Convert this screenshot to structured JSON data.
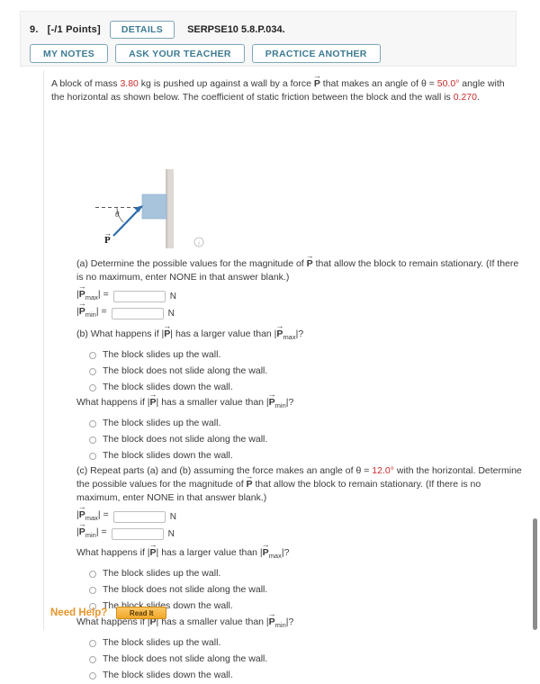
{
  "header": {
    "question_number": "9.",
    "points": "[-/1 Points]",
    "details_label": "DETAILS",
    "problem_code": "SERPSE10 5.8.P.034.",
    "my_notes_label": "MY NOTES",
    "ask_teacher_label": "ASK YOUR TEACHER",
    "practice_another_label": "PRACTICE ANOTHER"
  },
  "problem": {
    "text_part1": "A block of mass ",
    "mass_value": "3.80",
    "text_part2": " kg is pushed up against a wall by a force ",
    "force_symbol": "P",
    "text_part3": " that makes an angle of ",
    "theta_symbol": "θ",
    "equals": " = ",
    "angle_value": "50.0°",
    "text_part4": " angle with the horizontal as shown below. The coefficient of static friction between the block and the wall is ",
    "mu_value": "0.270",
    "text_part5": "."
  },
  "figure": {
    "angle_label": "θ",
    "force_label": "P",
    "watermark": "ⓘ"
  },
  "part_a": {
    "prompt_pre": "(a) Determine the possible values for the magnitude of ",
    "force_symbol": "P",
    "prompt_post": " that allow the block to remain stationary. (If there is no maximum, enter NONE in that answer blank.)",
    "max_label_base": "P",
    "max_label_sub": "max",
    "min_label_base": "P",
    "min_label_sub": "min",
    "max_value": "",
    "min_value": "",
    "unit": "N"
  },
  "part_b": {
    "prompt_larger_pre": "(b) What happens if |",
    "prompt_larger_mid": "| has a larger value than |",
    "prompt_larger_sub": "max",
    "prompt_larger_post": "|?",
    "prompt_smaller_pre": "What happens if |",
    "prompt_smaller_mid": "| has a smaller value than |",
    "prompt_smaller_sub": "min",
    "prompt_smaller_post": "|?",
    "force_symbol": "P",
    "options": [
      "The block slides up the wall.",
      "The block does not slide along the wall.",
      "The block slides down the wall."
    ]
  },
  "part_c": {
    "prompt_pre": "(c) Repeat parts (a) and (b) assuming the force makes an angle of ",
    "theta_symbol": "θ",
    "equals": " = ",
    "angle_value": "12.0°",
    "prompt_mid": " with the horizontal. Determine the possible values for the magnitude of ",
    "force_symbol": "P",
    "prompt_post": " that allow the block to remain stationary. (If there is no maximum, enter NONE in that answer blank.)",
    "max_label_base": "P",
    "max_label_sub": "max",
    "min_label_base": "P",
    "min_label_sub": "min",
    "max_value": "",
    "min_value": "",
    "unit": "N"
  },
  "footer": {
    "need_help_label": "Need Help?",
    "read_it_label": "Read It"
  },
  "colors": {
    "accent_button": "#3d7b92",
    "highlight_red": "#cc2b2b",
    "need_help_orange": "#e8952b",
    "block_blue": "#a8c4dd",
    "wall_gray": "#d9d4d0",
    "arrow_blue": "#2d6ca8"
  }
}
